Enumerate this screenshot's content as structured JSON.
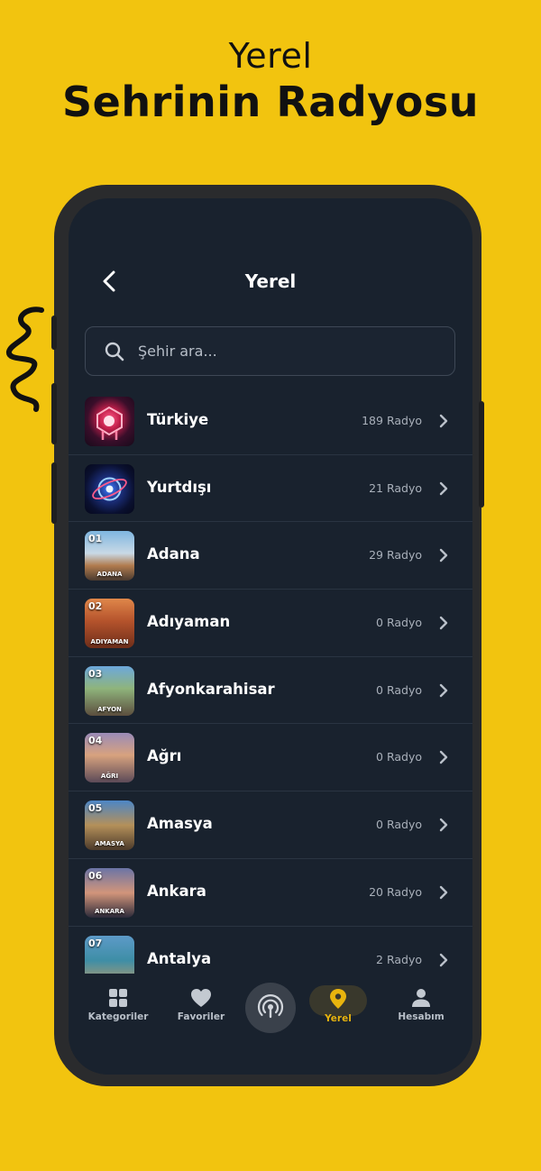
{
  "promo": {
    "line1": "Yerel",
    "line2": "Sehrinin Radyosu"
  },
  "header": {
    "title": "Yerel",
    "back_icon": "chevron-left-icon"
  },
  "search": {
    "placeholder": "Şehir ara...",
    "value": "",
    "icon": "search-icon"
  },
  "items": [
    {
      "name": "Türkiye",
      "count": "189 Radyo",
      "num": "",
      "thumb_label": "",
      "thumb": "turkiye"
    },
    {
      "name": "Yurtdışı",
      "count": "21 Radyo",
      "num": "",
      "thumb_label": "",
      "thumb": "globe"
    },
    {
      "name": "Adana",
      "count": "29 Radyo",
      "num": "01",
      "thumb_label": "ADANA",
      "thumb": "city"
    },
    {
      "name": "Adıyaman",
      "count": "0 Radyo",
      "num": "02",
      "thumb_label": "ADIYAMAN",
      "thumb": "city"
    },
    {
      "name": "Afyonkarahisar",
      "count": "0 Radyo",
      "num": "03",
      "thumb_label": "AFYON",
      "thumb": "city"
    },
    {
      "name": "Ağrı",
      "count": "0 Radyo",
      "num": "04",
      "thumb_label": "AĞRI",
      "thumb": "city"
    },
    {
      "name": "Amasya",
      "count": "0 Radyo",
      "num": "05",
      "thumb_label": "AMASYA",
      "thumb": "city"
    },
    {
      "name": "Ankara",
      "count": "20 Radyo",
      "num": "06",
      "thumb_label": "ANKARA",
      "thumb": "city"
    },
    {
      "name": "Antalya",
      "count": "2 Radyo",
      "num": "07",
      "thumb_label": "",
      "thumb": "city"
    }
  ],
  "tabs": [
    {
      "label": "Kategoriler",
      "icon": "grid-icon",
      "active": false
    },
    {
      "label": "Favoriler",
      "icon": "heart-icon",
      "active": false
    },
    {
      "label": "",
      "icon": "broadcast-icon",
      "active": false
    },
    {
      "label": "Yerel",
      "icon": "location-pin-icon",
      "active": true
    },
    {
      "label": "Hesabım",
      "icon": "user-icon",
      "active": false
    }
  ],
  "colors": {
    "background": "#F2C40F",
    "screen": "#19222E",
    "accent": "#E8B40E",
    "text_muted": "#A9B0BA"
  }
}
